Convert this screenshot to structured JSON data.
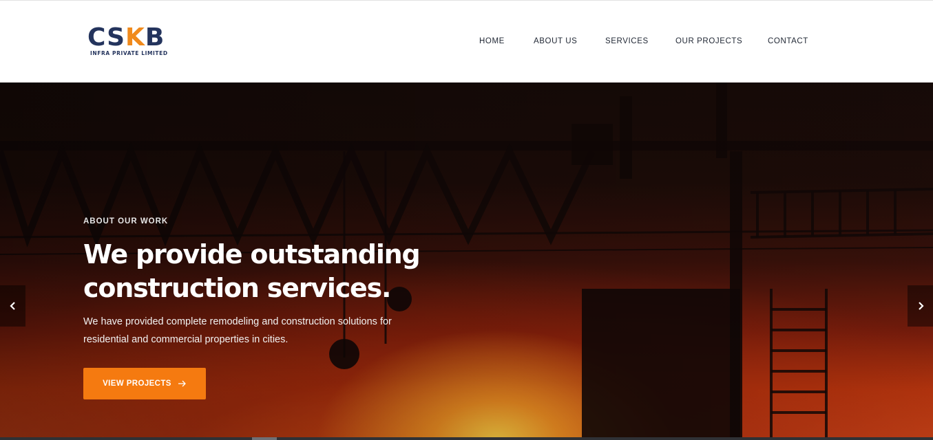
{
  "brand": {
    "logo_main_prefix": "CS",
    "logo_main_accent": "K",
    "logo_main_suffix": "B",
    "logo_sub": "INFRA PRIVATE LIMITED",
    "primary_color": "#24345d",
    "accent_color": "#f08a1c"
  },
  "nav": {
    "items": [
      {
        "label": "HOME"
      },
      {
        "label": "ABOUT US"
      },
      {
        "label": "SERVICES"
      },
      {
        "label": "OUR PROJECTS"
      },
      {
        "label": "CONTACT"
      }
    ]
  },
  "hero": {
    "eyebrow": "ABOUT OUR WORK",
    "headline_line1": "We provide outstanding",
    "headline_line2": "construction services.",
    "subtext_line1": "We have provided complete remodeling and construction solutions for",
    "subtext_line2": "residential and commercial properties in cities.",
    "cta_label": "VIEW PROJECTS",
    "cta_icon": "arrow-right-icon",
    "cta_color": "#f57a10",
    "prev_icon": "chevron-left-icon",
    "next_icon": "chevron-right-icon",
    "background": "crane-sunset-photo"
  }
}
